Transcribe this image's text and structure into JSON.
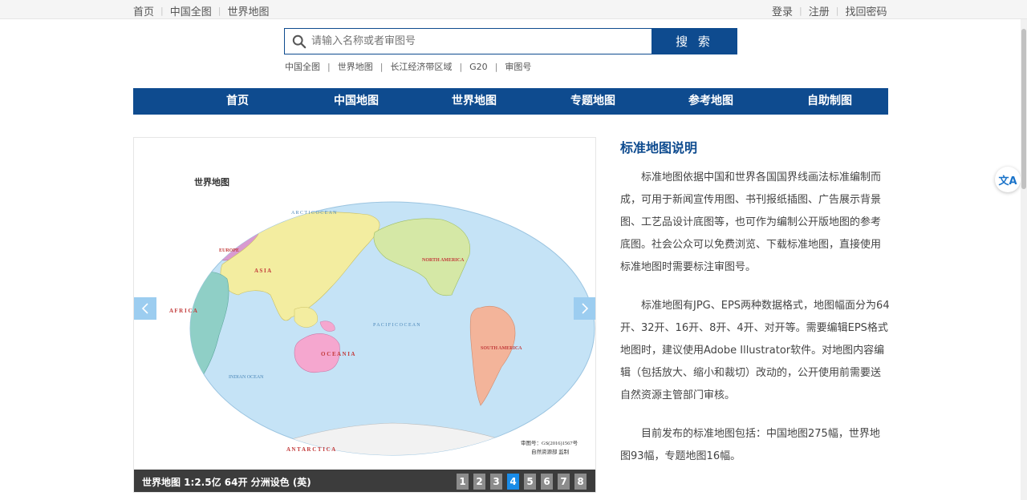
{
  "topbar": {
    "left_links": [
      {
        "label": "首页"
      },
      {
        "label": "中国全图"
      },
      {
        "label": "世界地图"
      }
    ],
    "right_links": [
      {
        "label": "登录"
      },
      {
        "label": "注册"
      },
      {
        "label": "找回密码"
      }
    ]
  },
  "search": {
    "placeholder": "请输入名称或者审图号",
    "button_label": "搜 索",
    "quick_links": [
      {
        "label": "中国全图"
      },
      {
        "label": "世界地图"
      },
      {
        "label": "长江经济带区域"
      },
      {
        "label": "G20"
      },
      {
        "label": "审图号"
      }
    ]
  },
  "nav": {
    "items": [
      {
        "label": "首页"
      },
      {
        "label": "中国地图"
      },
      {
        "label": "世界地图"
      },
      {
        "label": "专题地图"
      },
      {
        "label": "参考地图"
      },
      {
        "label": "自助制图"
      }
    ]
  },
  "slider": {
    "map": {
      "title": "世界地图",
      "labels": {
        "europe": "EUROPE",
        "asia": "A S I A",
        "africa": "A F R I C A",
        "north_america": "NORTH AMERICA",
        "south_america": "SOUTH AMERICA",
        "oceania": "O C E A N I A",
        "antarctica": "A N T A R C T I C A",
        "arctic_ocean": "A R C T I C   O C E A N",
        "pacific_ocean": "P A C I F I C   O C E A N",
        "indian_ocean": "INDIAN OCEAN"
      },
      "approval_line1": "审图号：GS(2016)1567号",
      "approval_line2": "自然资源部  监制",
      "colors": {
        "ocean": "#c5e3f6",
        "europe": "#d99ad0",
        "asia": "#f3eda0",
        "africa": "#8fcfc6",
        "north_america": "#d5e8a6",
        "south_america": "#f3b49a",
        "oceania": "#f5a7cf",
        "antarctica": "#f2f2f2"
      }
    },
    "caption": "世界地图 1:2.5亿 64开 分洲设色 (英)",
    "pages": [
      "1",
      "2",
      "3",
      "4",
      "5",
      "6",
      "7",
      "8"
    ],
    "active_page": "4"
  },
  "info": {
    "title": "标准地图说明",
    "paragraphs": [
      "标准地图依据中国和世界各国国界线画法标准编制而成，可用于新闻宣传用图、书刊报纸插图、广告展示背景图、工艺品设计底图等，也可作为编制公开版地图的参考底图。社会公众可以免费浏览、下载标准地图，直接使用标准地图时需要标注审图号。",
      "标准地图有JPG、EPS两种数据格式，地图幅面分为64开、32开、16开、8开、4开、对开等。需要编辑EPS格式地图时，建议使用Adobe Illustrator软件。对地图内容编辑（包括放大、缩小和裁切）改动的，公开使用前需要送自然资源主管部门审核。",
      "目前发布的标准地图包括：中国地图275幅，世界地图93幅，专题地图16幅。"
    ]
  },
  "translate_glyph": "文A"
}
